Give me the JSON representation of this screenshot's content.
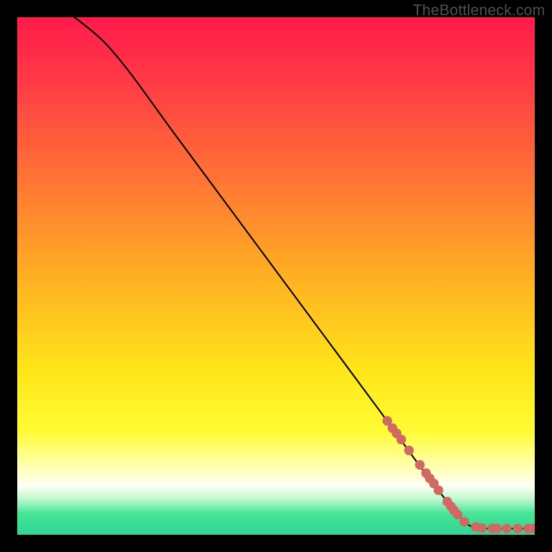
{
  "watermark": "TheBottleneck.com",
  "chart_data": {
    "type": "line",
    "title": "",
    "xlabel": "",
    "ylabel": "",
    "xlim": [
      0,
      100
    ],
    "ylim": [
      0,
      100
    ],
    "background": {
      "style": "vertical-gradient",
      "stops": [
        {
          "pos": 0.0,
          "color": "#ff1b4b"
        },
        {
          "pos": 0.12,
          "color": "#ff3946"
        },
        {
          "pos": 0.3,
          "color": "#ff7036"
        },
        {
          "pos": 0.5,
          "color": "#ffaf22"
        },
        {
          "pos": 0.68,
          "color": "#ffe51a"
        },
        {
          "pos": 0.8,
          "color": "#fffc33"
        },
        {
          "pos": 0.86,
          "color": "#ffffa2"
        },
        {
          "pos": 0.905,
          "color": "#fffff5"
        },
        {
          "pos": 0.93,
          "color": "#c2f8d0"
        },
        {
          "pos": 0.96,
          "color": "#43e494"
        },
        {
          "pos": 1.0,
          "color": "#32d694"
        }
      ]
    },
    "series": [
      {
        "name": "bottleneck-curve",
        "color": "#000000",
        "points": [
          {
            "x": 11,
            "y": 100
          },
          {
            "x": 13,
            "y": 98.5
          },
          {
            "x": 17,
            "y": 95
          },
          {
            "x": 22,
            "y": 89
          },
          {
            "x": 30,
            "y": 78
          },
          {
            "x": 40,
            "y": 64.5
          },
          {
            "x": 50,
            "y": 51
          },
          {
            "x": 60,
            "y": 37.5
          },
          {
            "x": 70,
            "y": 24
          },
          {
            "x": 78,
            "y": 13
          },
          {
            "x": 83,
            "y": 6.5
          },
          {
            "x": 85.5,
            "y": 3.5
          },
          {
            "x": 87,
            "y": 2
          },
          {
            "x": 89,
            "y": 1.3
          },
          {
            "x": 92,
            "y": 1.2
          },
          {
            "x": 100,
            "y": 1.2
          }
        ]
      }
    ],
    "markers": {
      "name": "highlighted-segment",
      "color": "#cf6a63",
      "radius": 7,
      "points": [
        {
          "x": 71.5,
          "y": 22.0
        },
        {
          "x": 72.5,
          "y": 20.6
        },
        {
          "x": 73.3,
          "y": 19.6
        },
        {
          "x": 74.2,
          "y": 18.4
        },
        {
          "x": 75.7,
          "y": 16.3
        },
        {
          "x": 77.8,
          "y": 13.5
        },
        {
          "x": 79.0,
          "y": 11.9
        },
        {
          "x": 79.7,
          "y": 10.9
        },
        {
          "x": 80.5,
          "y": 9.9
        },
        {
          "x": 81.4,
          "y": 8.6
        },
        {
          "x": 83.1,
          "y": 6.4
        },
        {
          "x": 83.8,
          "y": 5.5
        },
        {
          "x": 84.4,
          "y": 4.7
        },
        {
          "x": 85.1,
          "y": 3.9
        },
        {
          "x": 86.4,
          "y": 2.5
        },
        {
          "x": 88.6,
          "y": 1.5
        },
        {
          "x": 89.8,
          "y": 1.3
        },
        {
          "x": 91.8,
          "y": 1.2
        },
        {
          "x": 92.7,
          "y": 1.2
        },
        {
          "x": 94.6,
          "y": 1.2
        },
        {
          "x": 96.7,
          "y": 1.2
        },
        {
          "x": 98.7,
          "y": 1.2
        },
        {
          "x": 99.7,
          "y": 1.2
        }
      ]
    }
  }
}
